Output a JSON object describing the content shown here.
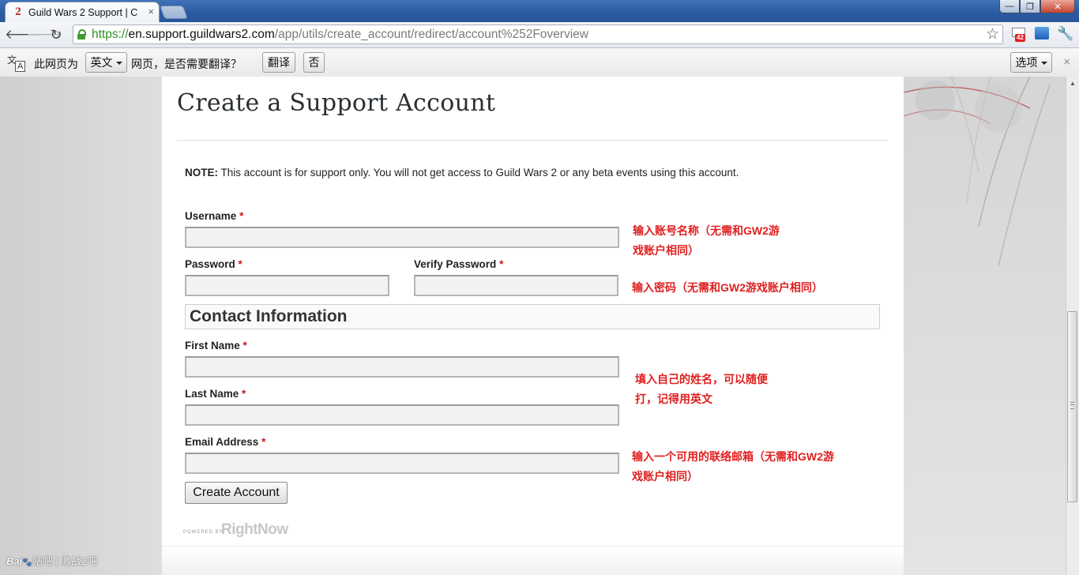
{
  "browser": {
    "tab_title": "Guild Wars 2 Support | C",
    "tab_close": "×",
    "url_scheme": "https://",
    "url_host": "en.support.guildwars2.com",
    "url_path": "/app/utils/create_account/redirect/account%252Foverview",
    "mail_badge": "42"
  },
  "translate_bar": {
    "prefix": "此网页为",
    "language": "英文",
    "suffix": "网页，是否需要翻译？",
    "translate_button": "翻译",
    "no_button": "否",
    "options_button": "选项",
    "close": "×"
  },
  "page": {
    "title": "Create a Support Account",
    "note_label": "NOTE:",
    "note_text": " This account is for support only. You will not get access to Guild Wars 2 or any beta events using this account.",
    "required_mark": "*",
    "fields": {
      "username": "Username",
      "password": "Password",
      "verify_password": "Verify Password",
      "first_name": "First Name",
      "last_name": "Last Name",
      "email": "Email Address"
    },
    "contact_section": "Contact Information",
    "create_button": "Create Account",
    "powered_by": "POWERED BY",
    "rightnow": "RightNow"
  },
  "annotations": {
    "username_line1": "输入账号名称（无需和GW2游",
    "username_line2": "戏账户相同）",
    "password": "输入密码（无需和GW2游戏账户相同）",
    "name_line1": "填入自己的姓名，可以随便",
    "name_line2": "打，记得用英文",
    "email_line1": "输入一个可用的联络邮箱（无需和GW2游",
    "email_line2": "戏账户相同）"
  },
  "watermark": {
    "logo": "Bai",
    "text": "贴吧 | 激战2吧"
  },
  "icons": {
    "back": "back-arrow-icon",
    "forward": "forward-arrow-icon",
    "reload": "reload-icon",
    "lock": "lock-icon",
    "star": "star-icon",
    "wrench": "wrench-icon"
  },
  "colors": {
    "annotation_red": "#e02020",
    "required_red": "#c8161d",
    "secure_green": "#2f8f28"
  }
}
